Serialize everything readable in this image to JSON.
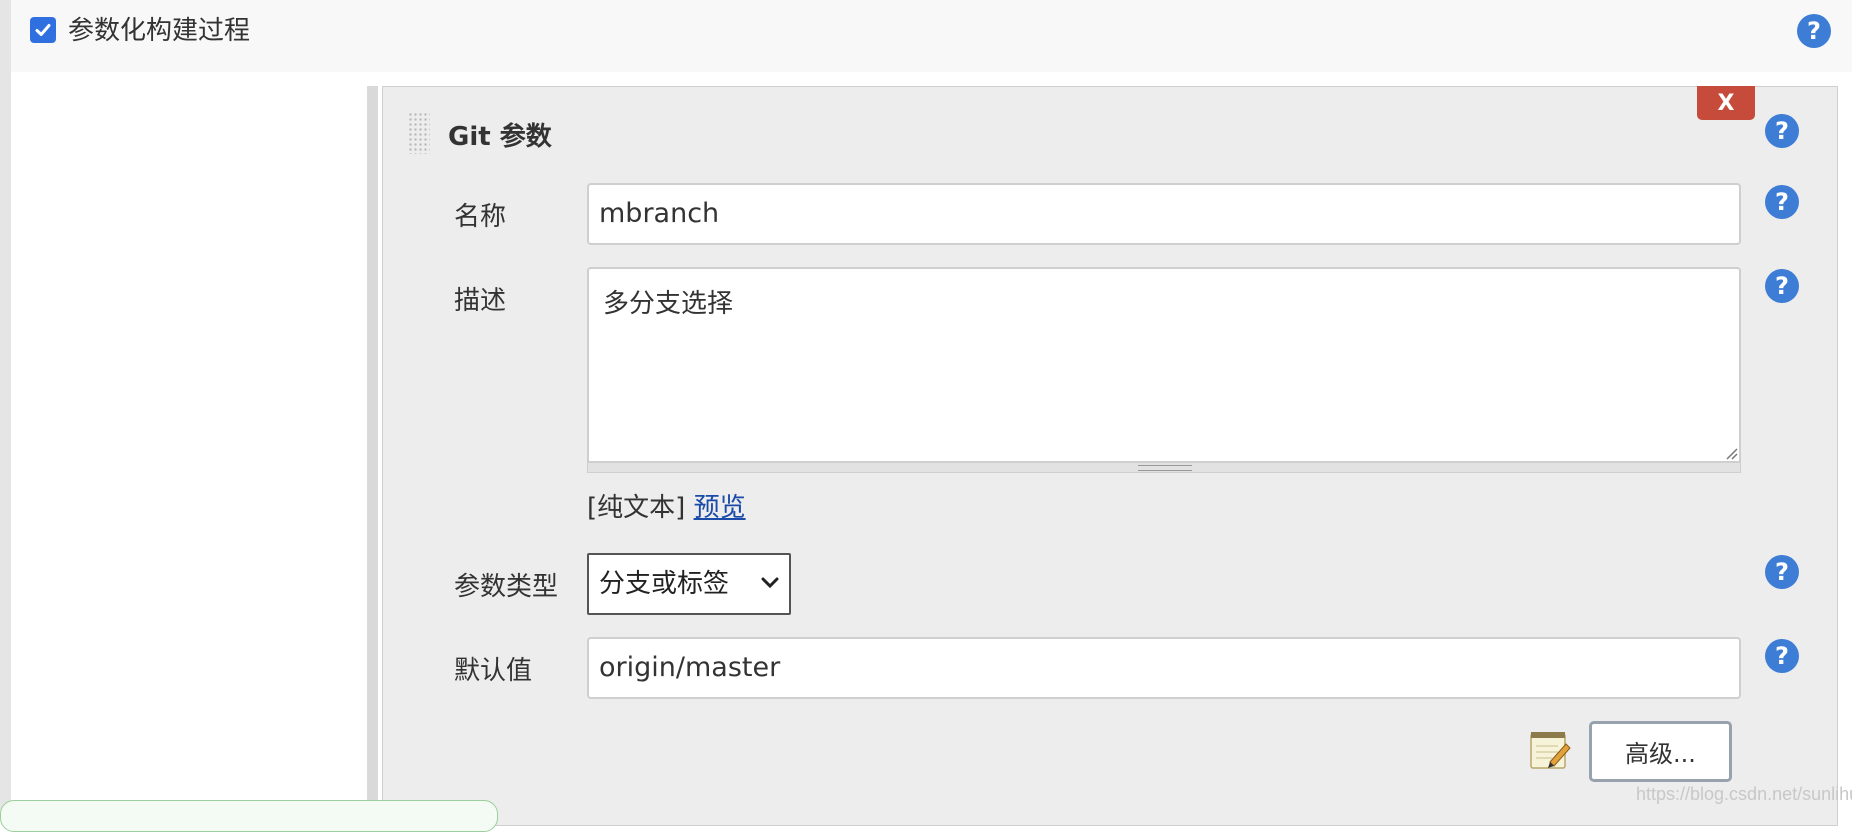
{
  "header": {
    "checkbox_checked": true,
    "title": "参数化构建过程",
    "help": "?"
  },
  "panel": {
    "title": "Git 参数",
    "delete_label": "X",
    "help": "?",
    "fields": {
      "name_label": "名称",
      "name_value": "mbranch",
      "description_label": "描述",
      "description_value": "多分支选择",
      "format_plain": "[纯文本]",
      "format_preview": "预览",
      "type_label": "参数类型",
      "type_value": "分支或标签",
      "default_label": "默认值",
      "default_value": "origin/master"
    },
    "advanced_label": "高级..."
  },
  "watermark": "https://blog.csdn.net/sunlihuo",
  "colors": {
    "accent": "#3d7dd6",
    "delete": "#c64b3a",
    "link": "#1a4ba8"
  }
}
